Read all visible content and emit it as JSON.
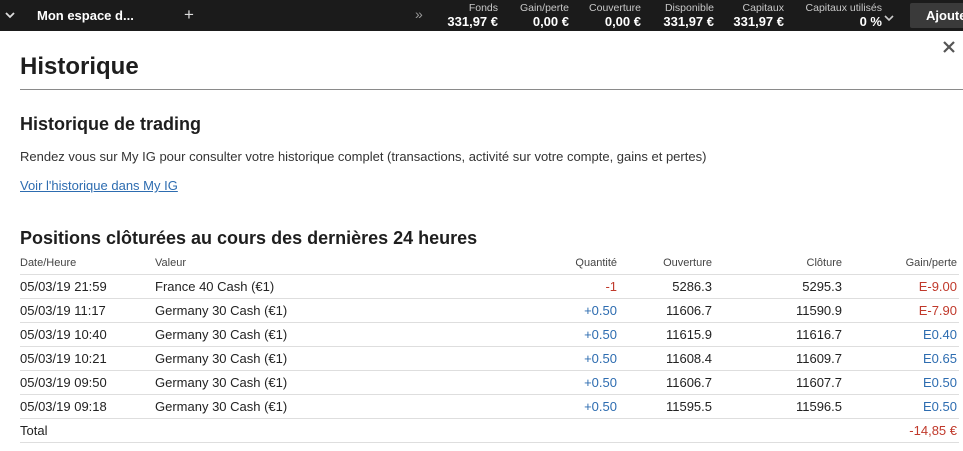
{
  "topbar": {
    "workspace_title": "Mon espace d...",
    "add_tab_symbol": "+",
    "more_symbol": "»",
    "stats": [
      {
        "label": "Fonds",
        "value": "331,97 €"
      },
      {
        "label": "Gain/perte",
        "value": "0,00 €"
      },
      {
        "label": "Couverture",
        "value": "0,00 €"
      },
      {
        "label": "Disponible",
        "value": "331,97 €"
      },
      {
        "label": "Capitaux",
        "value": "331,97 €"
      },
      {
        "label": "Capitaux utilisés",
        "value": "0 %"
      }
    ],
    "add_button_label": "Ajouter"
  },
  "panel": {
    "title": "Historique",
    "trading_heading": "Historique de trading",
    "trading_description": "Rendez vous sur My IG pour consulter votre historique complet (transactions, activité sur votre compte, gains et pertes)",
    "history_link": "Voir l'historique dans My IG",
    "closed_heading": "Positions clôturées au cours des dernières 24 heures"
  },
  "table": {
    "headers": {
      "date": "Date/Heure",
      "value": "Valeur",
      "qty": "Quantité",
      "open": "Ouverture",
      "close": "Clôture",
      "gain": "Gain/perte"
    },
    "rows": [
      {
        "date": "05/03/19 21:59",
        "value": "France 40 Cash (€1)",
        "qty": "-1",
        "open": "5286.3",
        "close": "5295.3",
        "gain": "E-9.00"
      },
      {
        "date": "05/03/19 11:17",
        "value": "Germany 30 Cash (€1)",
        "qty": "+0.50",
        "open": "11606.7",
        "close": "11590.9",
        "gain": "E-7.90"
      },
      {
        "date": "05/03/19 10:40",
        "value": "Germany 30 Cash (€1)",
        "qty": "+0.50",
        "open": "11615.9",
        "close": "11616.7",
        "gain": "E0.40"
      },
      {
        "date": "05/03/19 10:21",
        "value": "Germany 30 Cash (€1)",
        "qty": "+0.50",
        "open": "11608.4",
        "close": "11609.7",
        "gain": "E0.65"
      },
      {
        "date": "05/03/19 09:50",
        "value": "Germany 30 Cash (€1)",
        "qty": "+0.50",
        "open": "11606.7",
        "close": "11607.7",
        "gain": "E0.50"
      },
      {
        "date": "05/03/19 09:18",
        "value": "Germany 30 Cash (€1)",
        "qty": "+0.50",
        "open": "11595.5",
        "close": "11596.5",
        "gain": "E0.50"
      }
    ],
    "total_label": "Total",
    "total_value": "-14,85 €"
  },
  "colors": {
    "topbar_bg": "#1b1b1b",
    "positive": "#2d6cb0",
    "negative": "#c0392b",
    "link": "#2d6cb0"
  }
}
